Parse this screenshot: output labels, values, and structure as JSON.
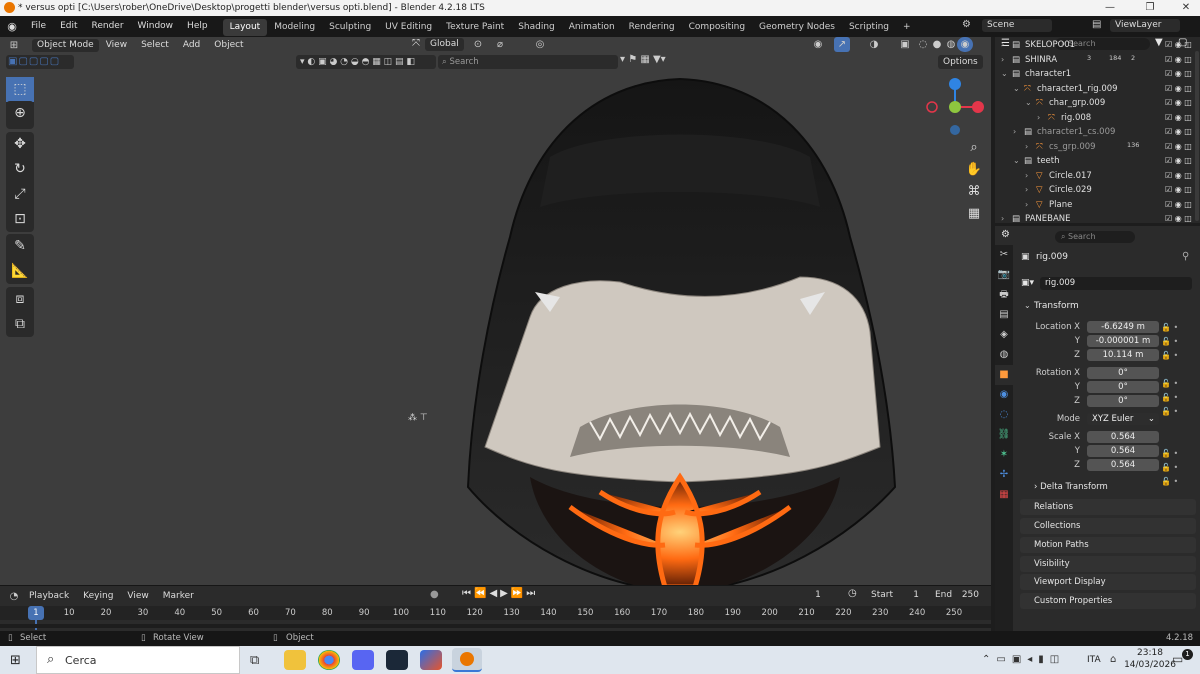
{
  "window": {
    "title": "* versus opti [C:\\Users\\rober\\OneDrive\\Desktop\\progetti blender\\versus opti.blend] - Blender 4.2.18 LTS",
    "minimize": "—",
    "restore": "❐",
    "close": "✕"
  },
  "menu": [
    "File",
    "Edit",
    "Render",
    "Window",
    "Help"
  ],
  "workspaces": [
    {
      "label": "Layout",
      "active": true
    },
    {
      "label": "Modeling"
    },
    {
      "label": "Sculpting"
    },
    {
      "label": "UV Editing"
    },
    {
      "label": "Texture Paint"
    },
    {
      "label": "Shading"
    },
    {
      "label": "Animation"
    },
    {
      "label": "Rendering"
    },
    {
      "label": "Compositing"
    },
    {
      "label": "Geometry Nodes"
    },
    {
      "label": "Scripting"
    }
  ],
  "add_workspace": "+",
  "scene": "Scene",
  "view_layer": "ViewLayer",
  "viewport_header": {
    "mode": "Object Mode",
    "menus": [
      "View",
      "Select",
      "Add",
      "Object"
    ],
    "orientation": "Global",
    "search_placeholder": "Search",
    "options": "Options"
  },
  "outliner": {
    "search_placeholder": "Search",
    "rows": [
      {
        "label": "SKELOPO01",
        "indent": 0
      },
      {
        "label": "SHINRA",
        "indent": 0,
        "badges": [
          "3",
          "184",
          "2"
        ]
      },
      {
        "label": "character1",
        "indent": 0
      },
      {
        "label": "character1_rig.009",
        "indent": 1
      },
      {
        "label": "char_grp.009",
        "indent": 2
      },
      {
        "label": "rig.008",
        "indent": 3
      },
      {
        "label": "character1_cs.009",
        "indent": 1
      },
      {
        "label": "cs_grp.009",
        "indent": 2,
        "badges": [
          "136"
        ]
      },
      {
        "label": "teeth",
        "indent": 1
      },
      {
        "label": "Circle.017",
        "indent": 2
      },
      {
        "label": "Circle.029",
        "indent": 2
      },
      {
        "label": "Plane",
        "indent": 2
      },
      {
        "label": "PANEBANE",
        "indent": 0
      }
    ],
    "shinra_badge2": "249"
  },
  "properties": {
    "search_placeholder": "Search",
    "object_name_header": "rig.009",
    "object_name_field": "rig.009",
    "transform_label": "Transform",
    "location_label": "Location X",
    "rotation_label": "Rotation X",
    "scale_label": "Scale X",
    "y_label": "Y",
    "z_label": "Z",
    "location": [
      "-6.6249 m",
      "-0.000001 m",
      "10.114 m"
    ],
    "rotation": [
      "0°",
      "0°",
      "0°"
    ],
    "mode_label": "Mode",
    "mode_value": "XYZ Euler",
    "scale": [
      "0.564",
      "0.564",
      "0.564"
    ],
    "delta_transform": "Delta Transform",
    "panels": [
      "Relations",
      "Collections",
      "Motion Paths",
      "Visibility",
      "Viewport Display",
      "Custom Properties"
    ]
  },
  "timeline": {
    "menus": [
      "Playback",
      "Keying",
      "View",
      "Marker"
    ],
    "current_frame": "1",
    "start_label": "Start",
    "start_value": "1",
    "end_label": "End",
    "end_value": "250",
    "ticks": [
      "1",
      "10",
      "20",
      "30",
      "40",
      "50",
      "60",
      "70",
      "80",
      "90",
      "100",
      "110",
      "120",
      "130",
      "140",
      "150",
      "160",
      "170",
      "180",
      "190",
      "200",
      "210",
      "220",
      "230",
      "240",
      "250"
    ]
  },
  "statusbar": {
    "select": "Select",
    "rotate": "Rotate View",
    "object": "Object",
    "version": "4.2.18"
  },
  "taskbar": {
    "search_label": "Cerca",
    "language": "ITA",
    "time": "23:18",
    "date": "14/03/2026",
    "notification_count": "1"
  },
  "colors": {
    "accent": "#4772b3",
    "axis_x": "#e3364a",
    "axis_y": "#8ec63f",
    "axis_z": "#2f84e3",
    "lava": "#ff6a12"
  }
}
